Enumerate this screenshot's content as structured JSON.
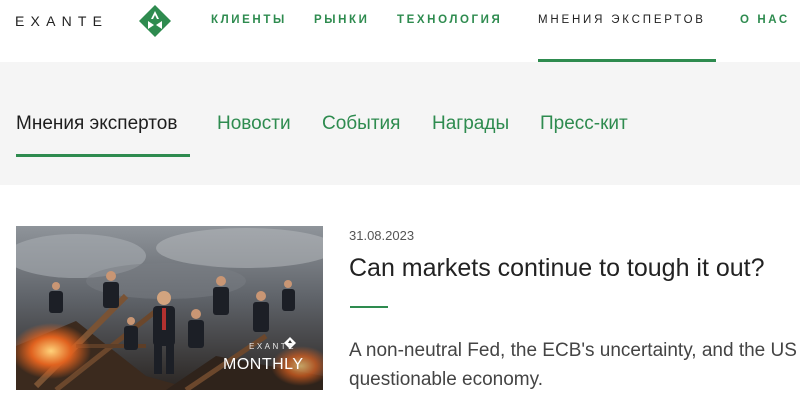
{
  "brand": {
    "logo_text": "EXANTE",
    "colors": {
      "accent": "#2e8b4f",
      "text": "#222222",
      "subnav_bg": "#f5f5f5"
    }
  },
  "nav": {
    "items": [
      {
        "label": "КЛИЕНТЫ"
      },
      {
        "label": "РЫНКИ"
      },
      {
        "label": "ТЕХНОЛОГИЯ"
      },
      {
        "label": "МНЕНИЯ ЭКСПЕРТОВ",
        "active": true
      },
      {
        "label": "О НАС"
      }
    ]
  },
  "subnav": {
    "items": [
      {
        "label": "Мнения экспертов",
        "active": true
      },
      {
        "label": "Новости"
      },
      {
        "label": "События"
      },
      {
        "label": "Награды"
      },
      {
        "label": "Пресс-кит"
      }
    ]
  },
  "article": {
    "date": "31.08.2023",
    "title": "Can markets continue to tough it out?",
    "excerpt": "A non-neutral Fed, the ECB's uncertainty, and the US questionable economy.",
    "image": {
      "brand": "EXANTE",
      "label": "MONTHLY",
      "icon": "exante-logo-icon"
    }
  }
}
